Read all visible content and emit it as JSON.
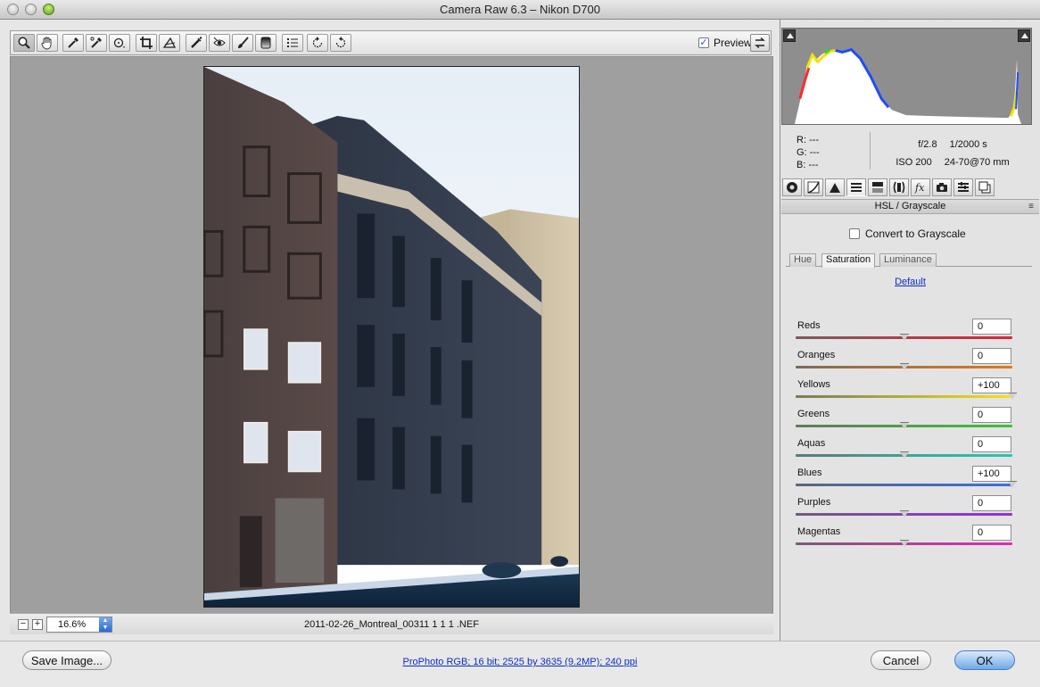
{
  "window": {
    "title": "Camera Raw 6.3  –  Nikon D700"
  },
  "toolbar": {
    "tools": [
      {
        "name": "zoom-tool",
        "icon": "magnifier-icon"
      },
      {
        "name": "hand-tool",
        "icon": "hand-icon"
      },
      {
        "name": "white-balance-tool",
        "icon": "eyedropper-icon"
      },
      {
        "name": "color-sampler-tool",
        "icon": "color-sampler-icon"
      },
      {
        "name": "targeted-adjustment-tool",
        "icon": "target-adjust-icon"
      },
      {
        "name": "crop-tool",
        "icon": "crop-icon"
      },
      {
        "name": "straighten-tool",
        "icon": "straighten-icon"
      },
      {
        "name": "spot-removal-tool",
        "icon": "spot-heal-icon"
      },
      {
        "name": "red-eye-tool",
        "icon": "red-eye-icon"
      },
      {
        "name": "adjustment-brush-tool",
        "icon": "brush-icon"
      },
      {
        "name": "graduated-filter-tool",
        "icon": "gradient-icon"
      },
      {
        "name": "preferences-tool",
        "icon": "list-icon"
      },
      {
        "name": "rotate-left-tool",
        "icon": "rotate-ccw-icon"
      },
      {
        "name": "rotate-right-tool",
        "icon": "rotate-cw-icon"
      }
    ],
    "preview_label": "Preview",
    "preview_checked": "✓"
  },
  "status": {
    "zoom_minus": "−",
    "zoom_plus": "+",
    "zoom_value": "16.6%",
    "filename": "2011-02-26_Montreal_00311 1 1 1 .NEF"
  },
  "info": {
    "r_label": "R:",
    "r_value": "---",
    "g_label": "G:",
    "g_value": "---",
    "b_label": "B:",
    "b_value": "---",
    "aperture": "f/2.8",
    "shutter": "1/2000 s",
    "iso": "ISO 200",
    "lens": "24-70@70 mm"
  },
  "panel": {
    "title": "HSL / Grayscale",
    "menu_icon": "≡",
    "grayscale_label": "Convert to Grayscale",
    "tabs": [
      "Hue",
      "Saturation",
      "Luminance"
    ],
    "active_tab": "Saturation",
    "default_link": "Default",
    "sliders": [
      {
        "label": "Reds",
        "value": "0",
        "fraction": 0.5,
        "color_from": "#7a5b5b",
        "color_to": "#e0233a"
      },
      {
        "label": "Oranges",
        "value": "0",
        "fraction": 0.5,
        "color_from": "#7a6b5b",
        "color_to": "#e07a1c"
      },
      {
        "label": "Yellows",
        "value": "+100",
        "fraction": 1.0,
        "color_from": "#7a7a5b",
        "color_to": "#f2e21a"
      },
      {
        "label": "Greens",
        "value": "0",
        "fraction": 0.5,
        "color_from": "#627a5b",
        "color_to": "#3fc23a"
      },
      {
        "label": "Aquas",
        "value": "0",
        "fraction": 0.5,
        "color_from": "#5b7a78",
        "color_to": "#22c9b4"
      },
      {
        "label": "Blues",
        "value": "+100",
        "fraction": 1.0,
        "color_from": "#5b667a",
        "color_to": "#3a6fe6"
      },
      {
        "label": "Purples",
        "value": "0",
        "fraction": 0.5,
        "color_from": "#6e5b7a",
        "color_to": "#9a2ee6"
      },
      {
        "label": "Magentas",
        "value": "0",
        "fraction": 0.5,
        "color_from": "#7a5b72",
        "color_to": "#e02bb8"
      }
    ]
  },
  "bottom": {
    "save_label": "Save Image...",
    "workflow": "ProPhoto RGB; 16 bit; 2525 by 3635 (9.2MP); 240 ppi",
    "cancel_label": "Cancel",
    "ok_label": "OK"
  }
}
